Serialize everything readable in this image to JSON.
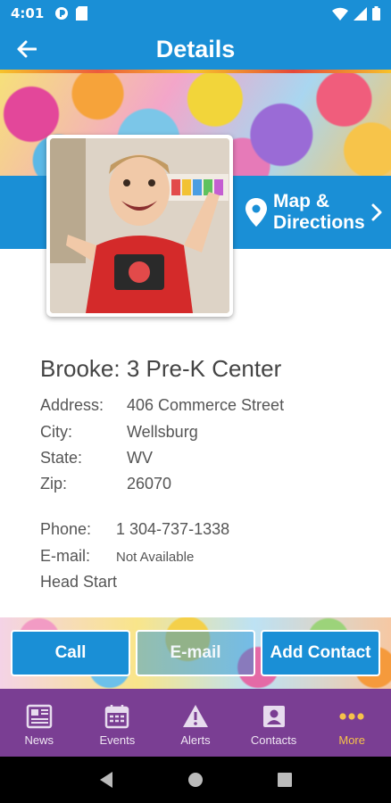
{
  "status_bar": {
    "time": "4:01",
    "left_icons": [
      "data-saver-icon",
      "sd-card-icon"
    ],
    "right_icons": [
      "wifi-icon",
      "signal-icon",
      "battery-icon"
    ]
  },
  "app_bar": {
    "title": "Details",
    "back_icon": "arrow-left-icon"
  },
  "map_link": {
    "line1": "Map &",
    "line2": "Directions",
    "icon": "map-pin-icon"
  },
  "center": {
    "name": "Brooke: 3 Pre-K Center",
    "address_label": "Address:",
    "address": "406 Commerce Street",
    "city_label": "City:",
    "city": "Wellsburg",
    "state_label": "State:",
    "state": "WV",
    "zip_label": "Zip:",
    "zip": "26070",
    "phone_label": "Phone:",
    "phone": "1 304-737-1338",
    "email_label": "E-mail:",
    "email": "Not Available",
    "program": "Head Start"
  },
  "actions": {
    "call": "Call",
    "email": "E-mail",
    "add_contact": "Add Contact"
  },
  "tabs": [
    {
      "label": "News",
      "icon": "newspaper-icon",
      "active": false
    },
    {
      "label": "Events",
      "icon": "calendar-icon",
      "active": false
    },
    {
      "label": "Alerts",
      "icon": "warning-icon",
      "active": false
    },
    {
      "label": "Contacts",
      "icon": "contact-card-icon",
      "active": false
    },
    {
      "label": "More",
      "icon": "more-dots-icon",
      "active": true
    }
  ],
  "colors": {
    "primary": "#1a8fd6",
    "tab_bar": "#7a3e93",
    "tab_active": "#f6c24a"
  }
}
